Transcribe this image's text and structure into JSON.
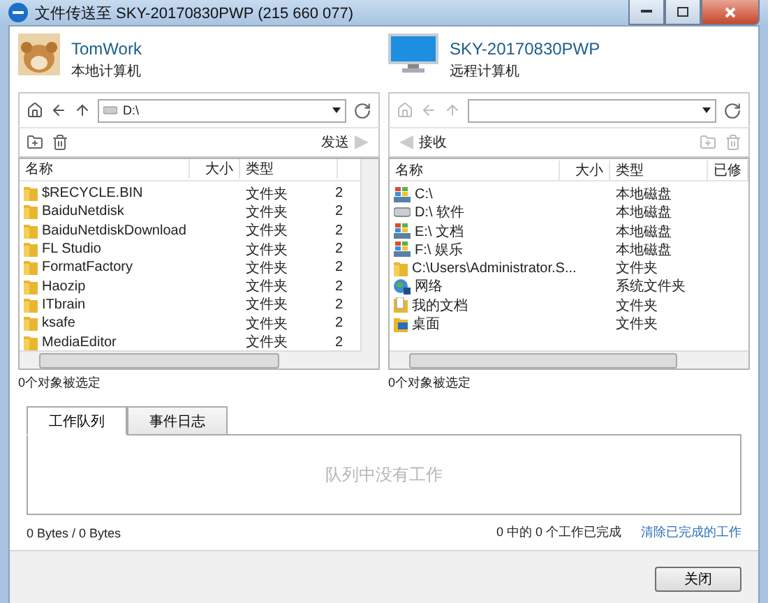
{
  "window": {
    "title": "文件传送至 SKY-20170830PWP (215 660 077)"
  },
  "local": {
    "name": "TomWork",
    "subtitle": "本地计算机"
  },
  "remote": {
    "name": "SKY-20170830PWP",
    "subtitle": "远程计算机"
  },
  "panels": [
    {
      "kind": "local",
      "path": "D:\\",
      "action": "发送",
      "columns": [
        "名称",
        "大小",
        "类型"
      ],
      "status": "0个对象被选定",
      "rows": [
        {
          "kind": "folder",
          "name": "$RECYCLE.BIN",
          "type": "文件夹",
          "column_4": "2"
        },
        {
          "kind": "folder",
          "name": "BaiduNetdisk",
          "type": "文件夹",
          "column_4": "2"
        },
        {
          "kind": "folder",
          "name": "BaiduNetdiskDownload",
          "type": "文件夹",
          "column_4": "2"
        },
        {
          "kind": "folder",
          "name": "FL Studio",
          "type": "文件夹",
          "column_4": "2"
        },
        {
          "kind": "folder",
          "name": "FormatFactory",
          "type": "文件夹",
          "column_4": "2"
        },
        {
          "kind": "folder",
          "name": "Haozip",
          "type": "文件夹",
          "column_4": "2"
        },
        {
          "kind": "folder",
          "name": "ITbrain",
          "type": "文件夹",
          "column_4": "2"
        },
        {
          "kind": "folder",
          "name": "ksafe",
          "type": "文件夹",
          "column_4": "2"
        },
        {
          "kind": "folder",
          "name": "MediaEditor",
          "type": "文件夹",
          "column_4": "2"
        }
      ]
    },
    {
      "kind": "remote",
      "action": "接收",
      "columns": [
        "名称",
        "大小",
        "类型",
        "已修"
      ],
      "status": "0个对象被选定",
      "rows": [
        {
          "kind": "system-drive",
          "name": "C:\\",
          "type": "本地磁盘"
        },
        {
          "kind": "drive",
          "name": "D:\\  软件",
          "type": "本地磁盘"
        },
        {
          "kind": "system-drive",
          "name": "E:\\  文档",
          "type": "本地磁盘"
        },
        {
          "kind": "system-drive",
          "name": "F:\\  娱乐",
          "type": "本地磁盘"
        },
        {
          "kind": "folder",
          "name": "C:\\Users\\Administrator.S...",
          "type": "文件夹"
        },
        {
          "kind": "network",
          "name": "网络",
          "type": "系统文件夹"
        },
        {
          "kind": "documents",
          "name": "我的文档",
          "type": "文件夹"
        },
        {
          "kind": "desktop",
          "name": "桌面",
          "type": "文件夹"
        }
      ]
    }
  ],
  "tabs": [
    {
      "label": "工作队列",
      "selected": true
    },
    {
      "label": "事件日志",
      "selected": false
    }
  ],
  "queue": {
    "empty_text": "队列中没有工作"
  },
  "progress": {
    "bytes": "0 Bytes / 0 Bytes",
    "summary": "0 中的 0 个工作已完成",
    "clear_link": "清除已完成的工作"
  },
  "buttons": [
    "关闭"
  ]
}
